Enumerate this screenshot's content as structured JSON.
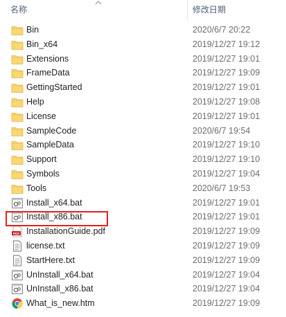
{
  "header": {
    "name_label": "名称",
    "date_label": "修改日期"
  },
  "files": [
    {
      "name": "Bin",
      "date": "2020/6/7 20:22",
      "icon": "folder-icon"
    },
    {
      "name": "Bin_x64",
      "date": "2019/12/27 19:12",
      "icon": "folder-icon"
    },
    {
      "name": "Extensions",
      "date": "2019/12/27 19:01",
      "icon": "folder-icon"
    },
    {
      "name": "FrameData",
      "date": "2019/12/27 19:09",
      "icon": "folder-icon"
    },
    {
      "name": "GettingStarted",
      "date": "2019/12/27 19:01",
      "icon": "folder-icon"
    },
    {
      "name": "Help",
      "date": "2019/12/27 19:08",
      "icon": "folder-icon"
    },
    {
      "name": "License",
      "date": "2019/12/27 19:01",
      "icon": "folder-icon"
    },
    {
      "name": "SampleCode",
      "date": "2020/6/7 19:54",
      "icon": "folder-icon"
    },
    {
      "name": "SampleData",
      "date": "2019/12/27 19:10",
      "icon": "folder-icon"
    },
    {
      "name": "Support",
      "date": "2019/12/27 19:10",
      "icon": "folder-icon"
    },
    {
      "name": "Symbols",
      "date": "2019/12/27 19:04",
      "icon": "folder-icon"
    },
    {
      "name": "Tools",
      "date": "2020/6/7 19:53",
      "icon": "folder-icon"
    },
    {
      "name": "Install_x64.bat",
      "date": "2019/12/27 19:01",
      "icon": "bat-file-icon"
    },
    {
      "name": "Install_x86.bat",
      "date": "2019/12/27 19:01",
      "icon": "bat-file-icon"
    },
    {
      "name": "InstallationGuide.pdf",
      "date": "2019/12/27 19:09",
      "icon": "pdf-file-icon"
    },
    {
      "name": "license.txt",
      "date": "2019/12/27 19:09",
      "icon": "text-file-icon"
    },
    {
      "name": "StartHere.txt",
      "date": "2019/12/27 19:09",
      "icon": "text-file-icon"
    },
    {
      "name": "UnInstall_x64.bat",
      "date": "2019/12/27 19:04",
      "icon": "bat-file-icon"
    },
    {
      "name": "UnInstall_x86.bat",
      "date": "2019/12/27 19:04",
      "icon": "bat-file-icon"
    },
    {
      "name": "What_is_new.htm",
      "date": "2019/12/27 19:09",
      "icon": "chrome-html-icon"
    }
  ],
  "highlight_color": "#e0201c",
  "folder_color": "#f8d775"
}
